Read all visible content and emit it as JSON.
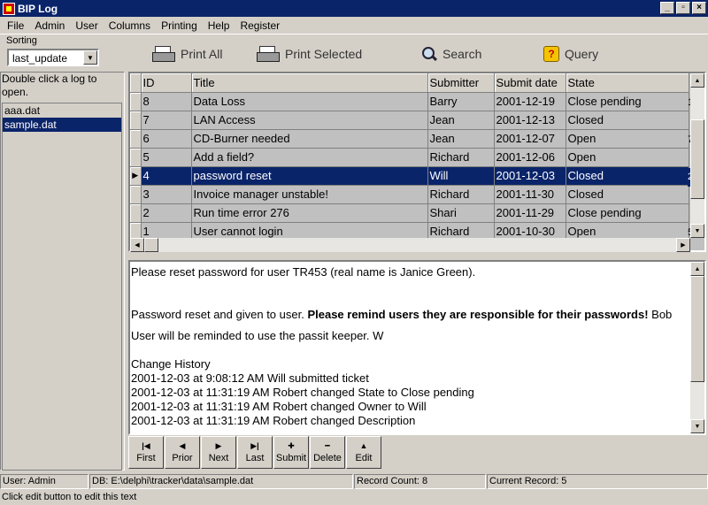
{
  "window": {
    "title": "BIP Log",
    "min": "_",
    "max": "▫",
    "close": "×"
  },
  "menu": [
    "File",
    "Admin",
    "User",
    "Columns",
    "Printing",
    "Help",
    "Register"
  ],
  "sorting": {
    "label": "Sorting",
    "value": "last_update"
  },
  "toolbar": {
    "print_all": "Print All",
    "print_selected": "Print Selected",
    "search": "Search",
    "query": "Query"
  },
  "sidebar": {
    "hint": "Double click a log to open.",
    "files": [
      "aaa.dat",
      "sample.dat"
    ],
    "selected_index": 1
  },
  "grid": {
    "columns": [
      "ID",
      "Title",
      "Submitter",
      "Submit date",
      "State"
    ],
    "rows": [
      {
        "id": "8",
        "title": "Data Loss",
        "submitter": "Barry",
        "date": "2001-12-19",
        "state": "Close pending"
      },
      {
        "id": "7",
        "title": "LAN Access",
        "submitter": "Jean",
        "date": "2001-12-13",
        "state": "Closed"
      },
      {
        "id": "6",
        "title": "CD-Burner needed",
        "submitter": "Jean",
        "date": "2001-12-07",
        "state": "Open"
      },
      {
        "id": "5",
        "title": "Add a field?",
        "submitter": "Richard",
        "date": "2001-12-06",
        "state": "Open"
      },
      {
        "id": "4",
        "title": "password reset",
        "submitter": "Will",
        "date": "2001-12-03",
        "state": "Closed"
      },
      {
        "id": "3",
        "title": "Invoice manager unstable!",
        "submitter": "Richard",
        "date": "2001-11-30",
        "state": "Closed"
      },
      {
        "id": "2",
        "title": "Run time error 276",
        "submitter": "Shari",
        "date": "2001-11-29",
        "state": "Close pending"
      },
      {
        "id": "1",
        "title": "User cannot login",
        "submitter": "Richard",
        "date": "2001-10-30",
        "state": "Open"
      }
    ],
    "selected_index": 4,
    "overflow_marks": [
      "1",
      "",
      "7",
      "",
      "2",
      "",
      "",
      "5"
    ]
  },
  "memo": {
    "line1": "Please reset password for user TR453 (real name is Janice Green).",
    "line2_plain": "Password reset and given to user.  ",
    "line2_bold": "Please remind users they are responsible for their passwords!",
    "line2_tail": " Bob",
    "line3": "User will be reminded to use the passit keeper. W",
    "history_title": "Change History",
    "history": [
      "2001-12-03 at 9:08:12 AM Will submitted ticket",
      "2001-12-03 at 11:31:19 AM Robert changed State to Close pending",
      "2001-12-03 at 11:31:19 AM Robert changed Owner to Will",
      "2001-12-03 at 11:31:19 AM Robert changed Description"
    ]
  },
  "nav": [
    {
      "label": "First",
      "icon": "|◀"
    },
    {
      "label": "Prior",
      "icon": "◀"
    },
    {
      "label": "Next",
      "icon": "▶"
    },
    {
      "label": "Last",
      "icon": "▶|"
    },
    {
      "label": "Submit",
      "icon": "✚"
    },
    {
      "label": "Delete",
      "icon": "━"
    },
    {
      "label": "Edit",
      "icon": "▲"
    }
  ],
  "status": {
    "user": "User: Admin",
    "db": "DB: E:\\delphi\\tracker\\data\\sample.dat",
    "count": "Record Count: 8",
    "current": "Current Record: 5"
  },
  "hint_bar": "Click edit button to edit this text"
}
